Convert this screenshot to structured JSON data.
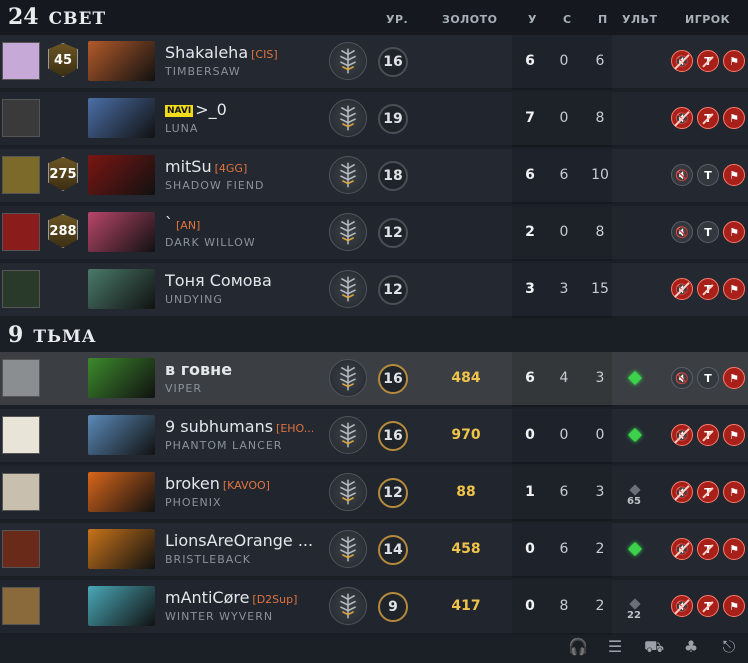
{
  "radiant": {
    "score": "24",
    "name": "СВЕТ"
  },
  "dire": {
    "score": "9",
    "name": "ТЬМА"
  },
  "columns": {
    "level": "УР.",
    "gold": "ЗОЛОТО",
    "kills": "У",
    "deaths": "С",
    "assists": "П",
    "ult": "УЛЬТ",
    "player": "ИГРОК"
  },
  "players": [
    {
      "name": "Shakaleha",
      "tag": "[CIS]",
      "hero": "TIMBERSAW",
      "rank": "45",
      "level": "16",
      "gold": "",
      "k": "6",
      "d": "0",
      "a": "6",
      "ult": "none",
      "ult_cd": "",
      "muted": true,
      "avatar_color": "#c7a9d8",
      "hero_color": "#b25a2a"
    },
    {
      "name": ">_0",
      "tag": "",
      "team_badge": "NAVI",
      "hero": "LUNA",
      "rank": "",
      "level": "19",
      "gold": "",
      "k": "7",
      "d": "0",
      "a": "8",
      "ult": "none",
      "ult_cd": "",
      "muted": true,
      "avatar_color": "#3a3a3a",
      "hero_color": "#4b6fa8"
    },
    {
      "name": "mitSu",
      "tag": "[4GG]",
      "hero": "SHADOW FIEND",
      "rank": "275",
      "level": "18",
      "gold": "",
      "k": "6",
      "d": "6",
      "a": "10",
      "ult": "none",
      "ult_cd": "",
      "muted": false,
      "avatar_color": "#7b6a2a",
      "hero_color": "#7a1612"
    },
    {
      "name": "`",
      "tag": "[AN]",
      "hero": "DARK WILLOW",
      "rank": "288",
      "level": "12",
      "gold": "",
      "k": "2",
      "d": "0",
      "a": "8",
      "ult": "none",
      "ult_cd": "",
      "muted": false,
      "avatar_color": "#8a1c1c",
      "hero_color": "#b8466a"
    },
    {
      "name": "Тоня Сомова",
      "tag": "",
      "hero": "UNDYING",
      "rank": "",
      "level": "12",
      "gold": "",
      "k": "3",
      "d": "3",
      "a": "15",
      "ult": "none",
      "ult_cd": "",
      "muted": true,
      "avatar_color": "#2a3a2a",
      "hero_color": "#4a7a6a"
    },
    {
      "name": "в говне",
      "tag": "",
      "hero": "VIPER",
      "rank": "",
      "level": "16",
      "gold": "484",
      "k": "6",
      "d": "4",
      "a": "3",
      "ult": "ready",
      "ult_cd": "",
      "muted": false,
      "self": true,
      "avatar_color": "#8a8e90",
      "hero_color": "#3c8a2c"
    },
    {
      "name": "9 subhumans",
      "tag": "[EHO...",
      "hero": "PHANTOM LANCER",
      "rank": "",
      "level": "16",
      "gold": "970",
      "k": "0",
      "d": "0",
      "a": "0",
      "ult": "ready",
      "ult_cd": "",
      "muted": true,
      "avatar_color": "#e8e4d8",
      "hero_color": "#5a8ab8"
    },
    {
      "name": "broken",
      "tag": "[KAVOO]",
      "hero": "PHOENIX",
      "rank": "",
      "level": "12",
      "gold": "88",
      "k": "1",
      "d": "6",
      "a": "3",
      "ult": "cooldown",
      "ult_cd": "65",
      "muted": true,
      "avatar_color": "#c8bfae",
      "hero_color": "#d8661a"
    },
    {
      "name": "LionsAreOrange ...",
      "tag": "",
      "hero": "BRISTLEBACK",
      "rank": "",
      "level": "14",
      "gold": "458",
      "k": "0",
      "d": "6",
      "a": "2",
      "ult": "ready",
      "ult_cd": "",
      "muted": true,
      "avatar_color": "#6a2a1a",
      "hero_color": "#c8741a"
    },
    {
      "name": "mAntiCøre",
      "tag": "[D2Sup]",
      "hero": "WINTER WYVERN",
      "rank": "",
      "level": "9",
      "gold": "417",
      "k": "0",
      "d": "8",
      "a": "2",
      "ult": "cooldown",
      "ult_cd": "22",
      "muted": true,
      "avatar_color": "#8a6a3a",
      "hero_color": "#4aa8b8"
    }
  ],
  "controls": {
    "voice": "🔇",
    "text": "T",
    "report": "⚑"
  },
  "bottom_icons": [
    "headset-icon",
    "list-icon",
    "shop-icon",
    "tree-icon",
    "exit-icon"
  ]
}
